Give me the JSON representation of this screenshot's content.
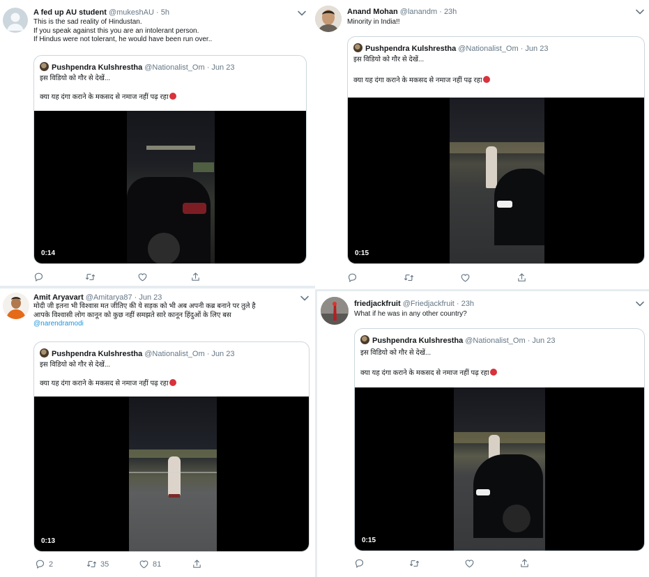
{
  "tweets": [
    {
      "name": "A fed up AU student",
      "handle": "@mukeshAU",
      "time": "· 5h",
      "lines": [
        "This is the sad reality of Hindustan.",
        "If you speak against this you are an intolerant person.",
        "If Hindus were not tolerant, he would have been run over.."
      ],
      "quote": {
        "name": "Pushpendra Kulshrestha",
        "handle": "@Nationalist_Om",
        "time": "· Jun 23",
        "line1": "इस विडियो को गौर से देखें...",
        "line2": "क्या यह दंगा कराने के मकसद से नमाज नहीं पढ़ रहा"
      },
      "duration": "0:14",
      "actions": {
        "reply": "",
        "retweet": "",
        "like": ""
      }
    },
    {
      "name": "Anand Mohan",
      "handle": "@lanandm",
      "time": "· 23h",
      "lines": [
        "Minority in India!!"
      ],
      "quote": {
        "name": "Pushpendra Kulshrestha",
        "handle": "@Nationalist_Om",
        "time": "· Jun 23",
        "line1": "इस विडियो को गौर से देखें...",
        "line2": "क्या यह दंगा कराने के मकसद से नमाज नहीं पढ़ रहा"
      },
      "duration": "0:15",
      "actions": {
        "reply": "",
        "retweet": "",
        "like": ""
      }
    },
    {
      "name": "Amit Aryavart",
      "handle": "@Amitarya87",
      "time": "· Jun 23",
      "lines": [
        "मोदी जी इतना भी विश्वास मत जीतिए की ये सड़क को भी अब अपनी कब्र बनाने पर तुले है",
        "आपके विश्वासी लोग कानून को कुछ नहीं समझते सारे कानून हिंदुओं के लिए बस"
      ],
      "mention": "@narendramodi",
      "quote": {
        "name": "Pushpendra Kulshrestha",
        "handle": "@Nationalist_Om",
        "time": "· Jun 23",
        "line1": "इस विडियो को गौर से देखें...",
        "line2": "क्या यह दंगा कराने के मकसद से नमाज नहीं पढ़ रहा"
      },
      "duration": "0:13",
      "actions": {
        "reply": "2",
        "retweet": "35",
        "like": "81"
      }
    },
    {
      "name": "friedjackfruit",
      "handle": "@Friedjackfruit",
      "time": "· 23h",
      "lines": [
        "What if he was in any other country?"
      ],
      "quote": {
        "name": "Pushpendra Kulshrestha",
        "handle": "@Nationalist_Om",
        "time": "· Jun 23",
        "line1": "इस विडियो को गौर से देखें...",
        "line2": "क्या यह दंगा कराने के मकसद से नमाज नहीं पढ़ रहा"
      },
      "duration": "0:15",
      "actions": {
        "reply": "",
        "retweet": "",
        "like": ""
      }
    }
  ],
  "colors": {
    "name": "#14171a",
    "meta": "#657786",
    "mention": "#1b95e0",
    "border": "#ccd6dd",
    "background": "#e6ecf0"
  },
  "icons": [
    "reply-icon",
    "retweet-icon",
    "like-icon",
    "share-icon",
    "chevron-down-icon",
    "angry-face-emoji"
  ]
}
